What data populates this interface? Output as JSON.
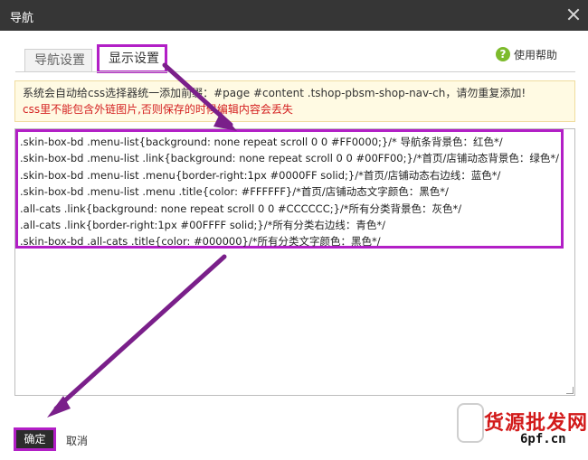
{
  "window": {
    "title": "导航"
  },
  "tabs": [
    {
      "label": "导航设置"
    },
    {
      "label": "显示设置"
    }
  ],
  "help": {
    "label": "使用帮助"
  },
  "notice": {
    "line1": "系统会自动给css选择器统一添加前缀：#page #content .tshop-pbsm-shop-nav-ch，请勿重复添加!",
    "line2": "css里不能包含外链图片,否则保存的时候编辑内容会丢失"
  },
  "editor": {
    "lines": [
      ".skin-box-bd .menu-list{background: none repeat scroll 0 0 #FF0000;}/* 导航条背景色：红色*/",
      ".skin-box-bd .menu-list .link{background: none repeat scroll 0 0 #00FF00;}/*首页/店铺动态背景色：绿色*/",
      ".skin-box-bd .menu-list .menu{border-right:1px #0000FF solid;}/*首页/店铺动态右边线：蓝色*/",
      ".skin-box-bd .menu-list .menu .title{color: #FFFFFF}/*首页/店铺动态文字颜色：黑色*/",
      ".all-cats .link{background: none repeat scroll 0 0 #CCCCCC;}/*所有分类背景色：灰色*/",
      ".all-cats .link{border-right:1px #00FFFF solid;}/*所有分类右边线：青色*/",
      ".skin-box-bd .all-cats .title{color: #000000}/*所有分类文字颜色：黑色*/"
    ]
  },
  "footer": {
    "ok_label": "确定",
    "cancel_label": "取消"
  },
  "watermark": {
    "text": "货源批发网",
    "url": "6pf.cn"
  },
  "colors": {
    "highlight": "#b21fc6",
    "titlebar": "#363636",
    "warning": "#d42020"
  }
}
